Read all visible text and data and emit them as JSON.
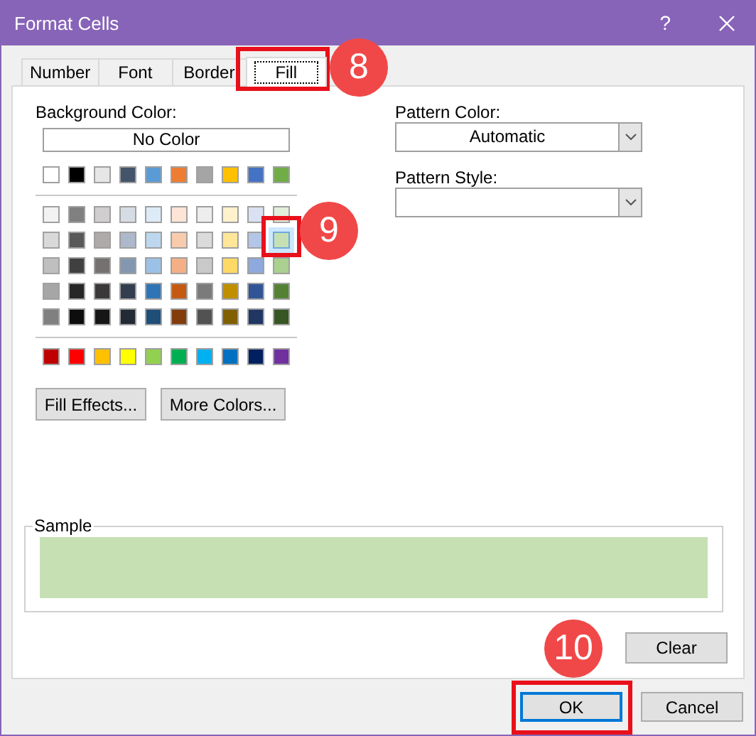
{
  "window": {
    "title": "Format Cells",
    "help_button": "?"
  },
  "tabs": [
    {
      "label": "Number",
      "selected": false
    },
    {
      "label": "Font",
      "selected": false
    },
    {
      "label": "Border",
      "selected": false
    },
    {
      "label": "Fill",
      "selected": true
    }
  ],
  "background_color": {
    "label": "Background Color:",
    "no_color_button": "No Color",
    "theme_colors": [
      {
        "color": "#ffffff",
        "selected": false
      },
      {
        "color": "#000000",
        "selected": false
      },
      {
        "color": "#e7e6e6",
        "selected": false
      },
      {
        "color": "#44546a",
        "selected": false
      },
      {
        "color": "#5b9bd5",
        "selected": false
      },
      {
        "color": "#ed7d31",
        "selected": false
      },
      {
        "color": "#a5a5a5",
        "selected": false
      },
      {
        "color": "#ffc000",
        "selected": false
      },
      {
        "color": "#4472c4",
        "selected": false
      },
      {
        "color": "#70ad47",
        "selected": false
      }
    ],
    "tint_rows": [
      [
        {
          "color": "#f2f2f2",
          "selected": false
        },
        {
          "color": "#808080",
          "selected": false
        },
        {
          "color": "#d0cece",
          "selected": false
        },
        {
          "color": "#d6dce4",
          "selected": false
        },
        {
          "color": "#ddebf7",
          "selected": false
        },
        {
          "color": "#fce4d6",
          "selected": false
        },
        {
          "color": "#ededed",
          "selected": false
        },
        {
          "color": "#fff2cc",
          "selected": false
        },
        {
          "color": "#d9e1f2",
          "selected": false
        },
        {
          "color": "#e2efda",
          "selected": false
        }
      ],
      [
        {
          "color": "#d9d9d9",
          "selected": false
        },
        {
          "color": "#595959",
          "selected": false
        },
        {
          "color": "#aeaaaa",
          "selected": false
        },
        {
          "color": "#adb9ca",
          "selected": false
        },
        {
          "color": "#bdd7ee",
          "selected": false
        },
        {
          "color": "#f8cbad",
          "selected": false
        },
        {
          "color": "#dbdbdb",
          "selected": false
        },
        {
          "color": "#ffe699",
          "selected": false
        },
        {
          "color": "#b4c6e7",
          "selected": false
        },
        {
          "color": "#c6e0b4",
          "selected": true
        }
      ],
      [
        {
          "color": "#bfbfbf",
          "selected": false
        },
        {
          "color": "#404040",
          "selected": false
        },
        {
          "color": "#757171",
          "selected": false
        },
        {
          "color": "#8497b0",
          "selected": false
        },
        {
          "color": "#9bc2e6",
          "selected": false
        },
        {
          "color": "#f4b084",
          "selected": false
        },
        {
          "color": "#c9c9c9",
          "selected": false
        },
        {
          "color": "#ffd966",
          "selected": false
        },
        {
          "color": "#8ea9db",
          "selected": false
        },
        {
          "color": "#a9d08e",
          "selected": false
        }
      ],
      [
        {
          "color": "#a6a6a6",
          "selected": false
        },
        {
          "color": "#262626",
          "selected": false
        },
        {
          "color": "#3a3838",
          "selected": false
        },
        {
          "color": "#333f4f",
          "selected": false
        },
        {
          "color": "#2f75b5",
          "selected": false
        },
        {
          "color": "#c65911",
          "selected": false
        },
        {
          "color": "#7b7b7b",
          "selected": false
        },
        {
          "color": "#bf8f00",
          "selected": false
        },
        {
          "color": "#305496",
          "selected": false
        },
        {
          "color": "#548235",
          "selected": false
        }
      ],
      [
        {
          "color": "#808080",
          "selected": false
        },
        {
          "color": "#0d0d0d",
          "selected": false
        },
        {
          "color": "#171616",
          "selected": false
        },
        {
          "color": "#222b35",
          "selected": false
        },
        {
          "color": "#1f4e78",
          "selected": false
        },
        {
          "color": "#833c0c",
          "selected": false
        },
        {
          "color": "#525252",
          "selected": false
        },
        {
          "color": "#806000",
          "selected": false
        },
        {
          "color": "#203764",
          "selected": false
        },
        {
          "color": "#375623",
          "selected": false
        }
      ]
    ],
    "standard_colors": [
      {
        "color": "#c00000",
        "selected": false
      },
      {
        "color": "#ff0000",
        "selected": false
      },
      {
        "color": "#ffc000",
        "selected": false
      },
      {
        "color": "#ffff00",
        "selected": false
      },
      {
        "color": "#92d050",
        "selected": false
      },
      {
        "color": "#00b050",
        "selected": false
      },
      {
        "color": "#00b0f0",
        "selected": false
      },
      {
        "color": "#0070c0",
        "selected": false
      },
      {
        "color": "#002060",
        "selected": false
      },
      {
        "color": "#7030a0",
        "selected": false
      }
    ],
    "buttons": [
      "Fill Effects...",
      "More Colors..."
    ]
  },
  "pattern_color": {
    "label": "Pattern Color:",
    "value": "Automatic"
  },
  "pattern_style": {
    "label": "Pattern Style:"
  },
  "sample": {
    "label": "Sample",
    "color": "#c6e0b4"
  },
  "clear_button": "Clear",
  "buttons": [
    {
      "label": "OK",
      "default": true
    },
    {
      "label": "Cancel",
      "default": false
    }
  ],
  "annotations": [
    {
      "label": "8"
    },
    {
      "label": "9"
    },
    {
      "label": "10"
    }
  ]
}
